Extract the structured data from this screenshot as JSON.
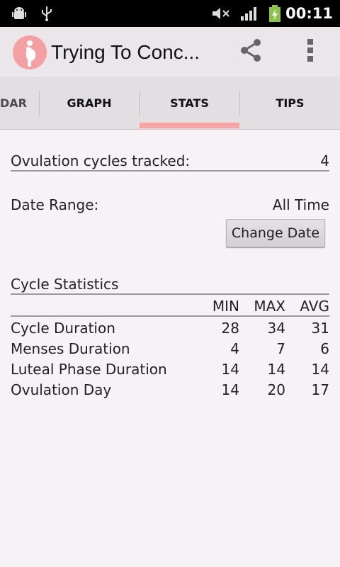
{
  "status_bar": {
    "time": "00:11",
    "icons": [
      "android-debug-icon",
      "usb-icon",
      "mute-icon",
      "signal-icon",
      "battery-charging-icon"
    ]
  },
  "app": {
    "title": "Trying To Conc...",
    "accent_color": "#f4a0a2"
  },
  "tabs": [
    {
      "label": "DAR"
    },
    {
      "label": "GRAPH"
    },
    {
      "label": "STATS",
      "selected": true
    },
    {
      "label": "TIPS"
    }
  ],
  "stats": {
    "cycles_tracked_label": "Ovulation cycles tracked:",
    "cycles_tracked_value": "4",
    "date_range_label": "Date Range:",
    "date_range_value": "All Time",
    "change_date_button": "Change Date",
    "cycle_statistics_title": "Cycle Statistics",
    "columns": [
      "MIN",
      "MAX",
      "AVG"
    ],
    "rows": [
      {
        "label": "Cycle Duration",
        "min": "28",
        "max": "34",
        "avg": "31"
      },
      {
        "label": "Menses Duration",
        "min": "4",
        "max": "7",
        "avg": "6"
      },
      {
        "label": "Luteal Phase Duration",
        "min": "14",
        "max": "14",
        "avg": "14"
      },
      {
        "label": "Ovulation Day",
        "min": "14",
        "max": "20",
        "avg": "17"
      }
    ]
  }
}
